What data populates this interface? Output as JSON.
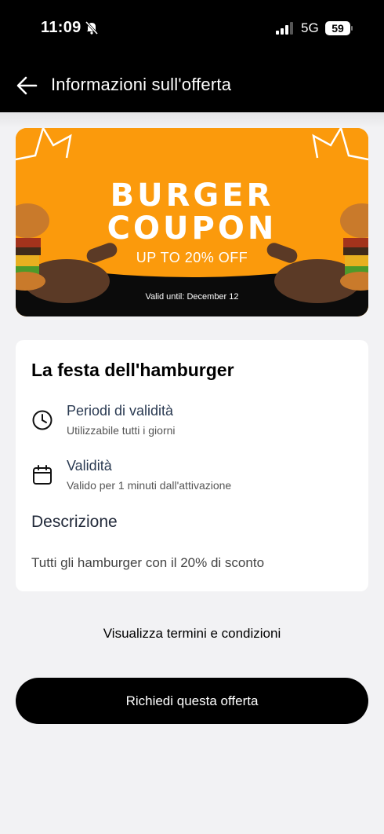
{
  "status_bar": {
    "time": "11:09",
    "network": "5G",
    "battery": "59",
    "icons": [
      "bell-slash-icon",
      "signal-icon"
    ]
  },
  "header": {
    "title": "Informazioni sull'offerta",
    "back_icon": "arrow-left-icon"
  },
  "banner": {
    "line1": "BURGER",
    "line2": "COUPON",
    "subtitle": "UP TO 20% OFF",
    "valid": "Valid until: December 12",
    "colors": {
      "background": "#fb9a0c",
      "bottom": "#0b0b0b"
    }
  },
  "offer": {
    "title": "La festa dell'hamburger",
    "validity_period": {
      "title": "Periodi di validità",
      "subtitle": "Utilizzabile tutti i giorni",
      "icon": "clock-icon"
    },
    "validity": {
      "title": "Validità",
      "subtitle": "Valido per 1 minuti dall'attivazione",
      "icon": "calendar-icon"
    },
    "description_heading": "Descrizione",
    "description": "Tutti gli hamburger con il 20% di sconto"
  },
  "terms_link": "Visualizza termini e condizioni",
  "cta_label": "Richiedi questa offerta"
}
